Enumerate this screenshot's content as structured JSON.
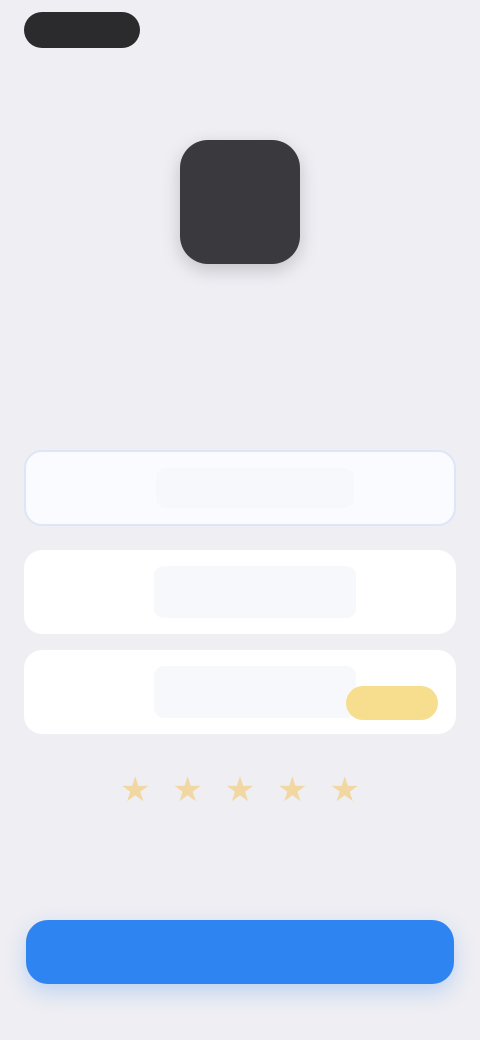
{
  "header": {
    "left_label": "",
    "right_label": "",
    "right_sublabel": ""
  },
  "app": {
    "icon_text": "",
    "title": "",
    "subtitle": ""
  },
  "cards": [
    {
      "label": "",
      "sublabel": "",
      "action": ""
    },
    {
      "label": "",
      "sublabel": "",
      "action": ""
    },
    {
      "label": "",
      "sublabel": "",
      "badge_top": "",
      "badge": ""
    }
  ],
  "rating": {
    "stars_total": 5,
    "text": "",
    "subtext": ""
  },
  "primary_button": {
    "label": ""
  },
  "footer": {
    "text": ""
  },
  "colors": {
    "background": "#EEEEF3",
    "primary": "#2E84F0",
    "badge": "#F6DE8E",
    "star": "#F1D7A2",
    "app_icon": "#3A3A3E"
  }
}
